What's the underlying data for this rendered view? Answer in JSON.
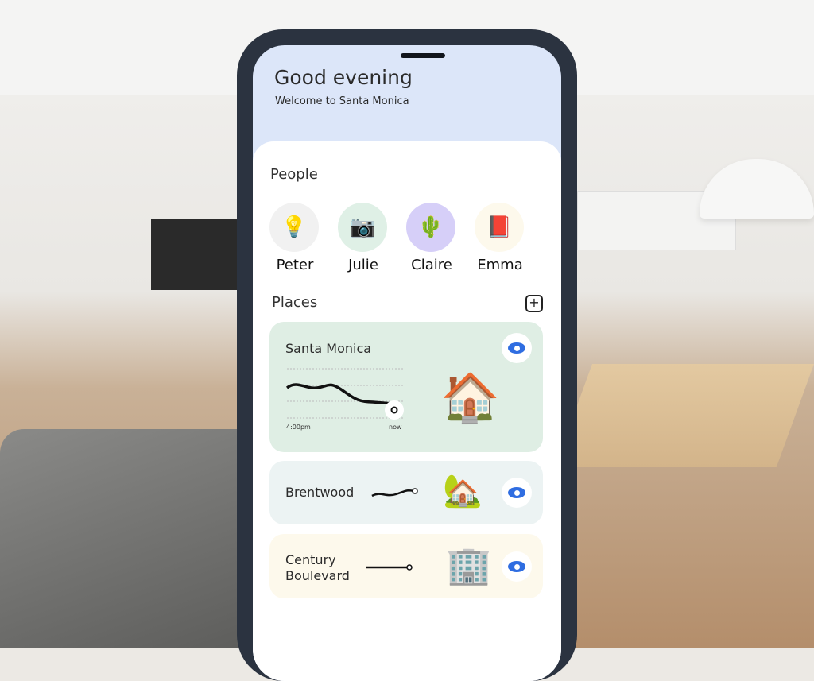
{
  "header": {
    "title": "Good evening",
    "subtitle": "Welcome to Santa Monica"
  },
  "people": {
    "title": "People",
    "items": [
      {
        "name": "Peter",
        "icon": "lamp-icon",
        "bg": "#f1f1f1"
      },
      {
        "name": "Julie",
        "icon": "camera-icon",
        "bg": "#dff0e6"
      },
      {
        "name": "Claire",
        "icon": "cactus-icon",
        "bg": "#d6cff8"
      },
      {
        "name": "Emma",
        "icon": "book-icon",
        "bg": "#fdf9ec"
      }
    ]
  },
  "places": {
    "title": "Places",
    "add_icon": "plus-icon",
    "items": [
      {
        "name": "Santa Monica",
        "bg": "#dfeee4",
        "start_label": "4:00pm",
        "end_label": "now",
        "icon": "house-icon"
      },
      {
        "name": "Brentwood",
        "bg": "#ecf3f3",
        "icon": "modern-house-icon"
      },
      {
        "name": "Century Boulevard",
        "bg": "#fdf9ec",
        "icon": "office-building-icon"
      }
    ]
  },
  "colors": {
    "accent": "#2f6de1",
    "header_bg": "#dce6f9"
  }
}
